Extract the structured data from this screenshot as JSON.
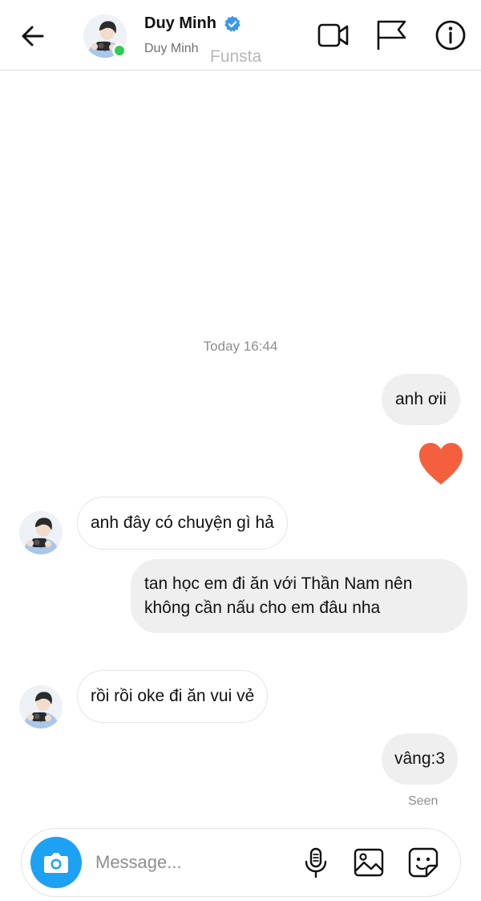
{
  "header": {
    "contact_name": "Duy Minh",
    "contact_username": "Duy Minh",
    "watermark": "Funsta",
    "verified": true,
    "online": true,
    "icons": [
      "back-arrow-icon",
      "video-call-icon",
      "flag-icon",
      "info-icon"
    ]
  },
  "thread": {
    "timestamp": "Today 16:44",
    "messages": [
      {
        "from": "me",
        "text": "anh ơii"
      },
      {
        "from": "me",
        "reaction": "heart"
      },
      {
        "from": "them",
        "text": "anh đây có chuyện gì hả"
      },
      {
        "from": "me",
        "text": "tan học em đi ăn với Thần Nam nên không cần nấu cho em đâu nha"
      },
      {
        "from": "them",
        "text": "rồi rồi oke đi ăn vui vẻ"
      },
      {
        "from": "me",
        "text": "vâng:3"
      }
    ],
    "seen_label": "Seen"
  },
  "composer": {
    "placeholder": "Message...",
    "icons": [
      "camera-icon",
      "microphone-icon",
      "gallery-icon",
      "sticker-icon"
    ]
  },
  "colors": {
    "accent_blue": "#1da1f2",
    "online_green": "#2ecc4f",
    "heart": "#f4603e",
    "outgoing_bubble": "#efefef"
  }
}
